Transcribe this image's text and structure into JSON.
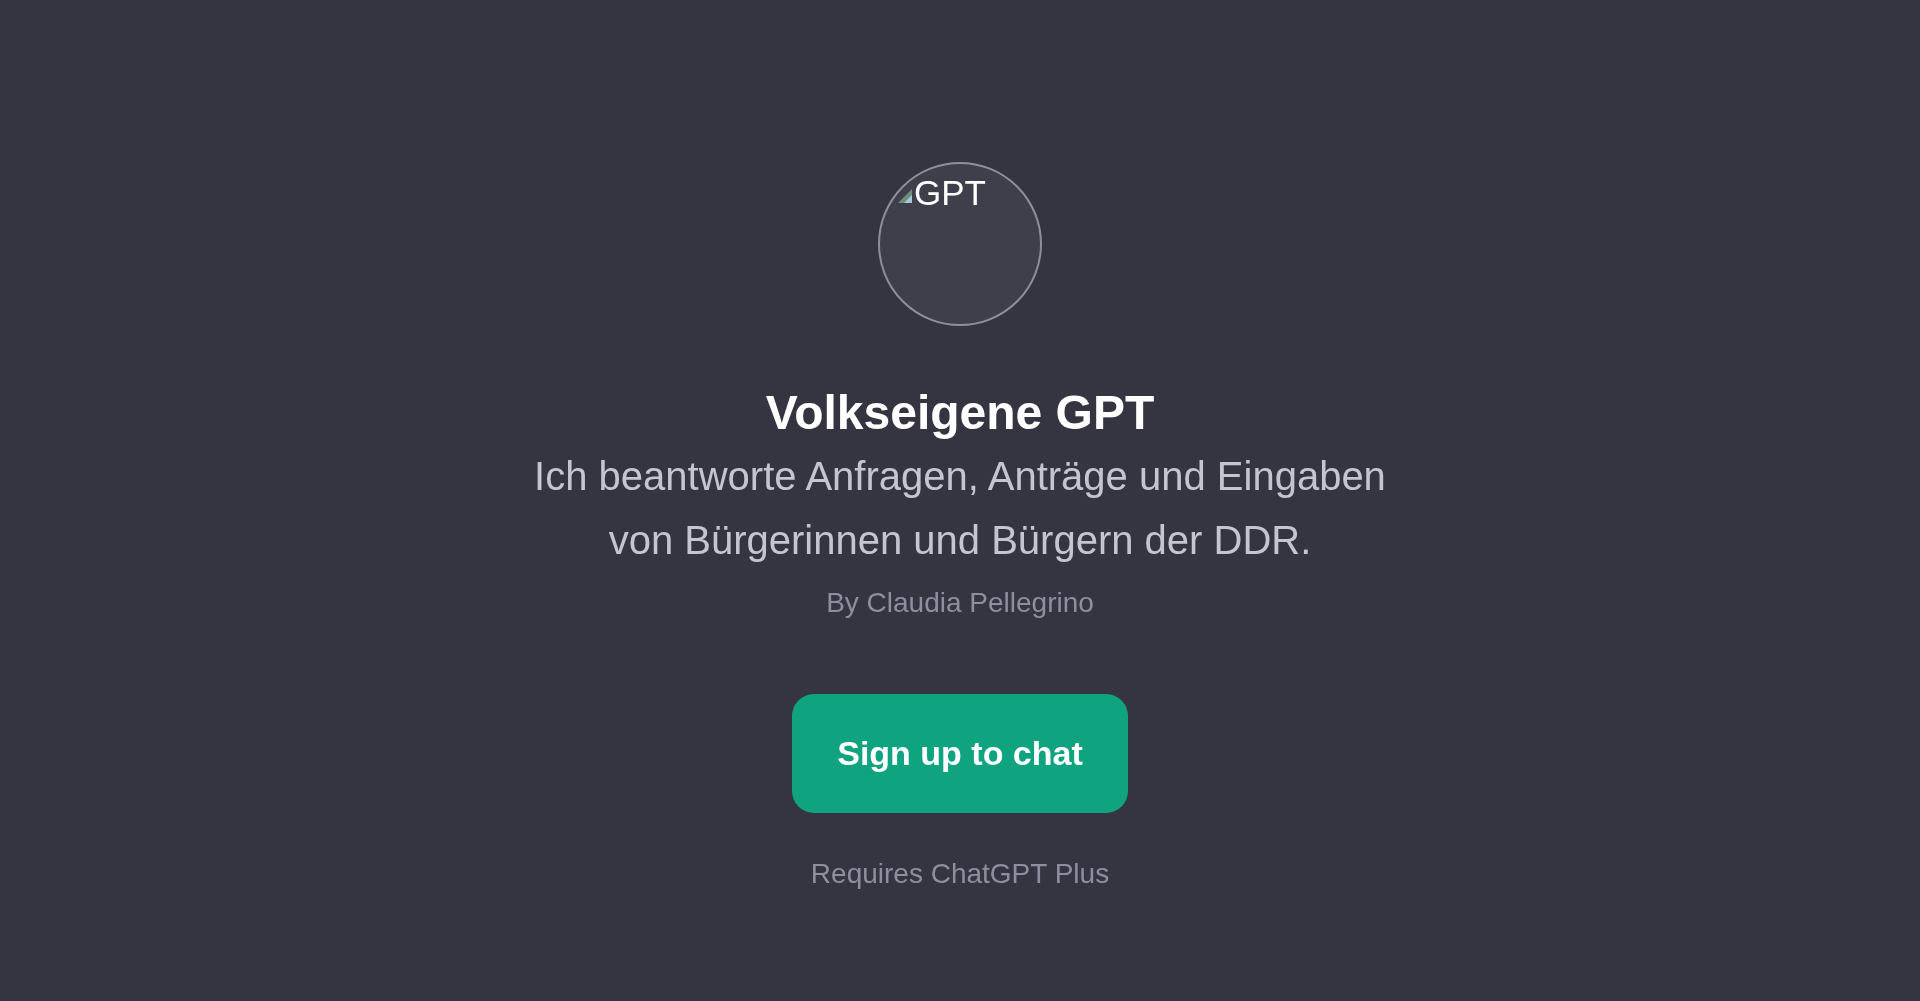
{
  "avatar": {
    "alt_text": "GPT"
  },
  "title": "Volkseigene GPT",
  "description_lines": [
    "Ich beantworte Anfragen, Anträge und Eingaben",
    "von Bürgerinnen und Bürgern der DDR."
  ],
  "author": "By Claudia Pellegrino",
  "button": {
    "label": "Sign up to chat"
  },
  "note": "Requires ChatGPT Plus"
}
